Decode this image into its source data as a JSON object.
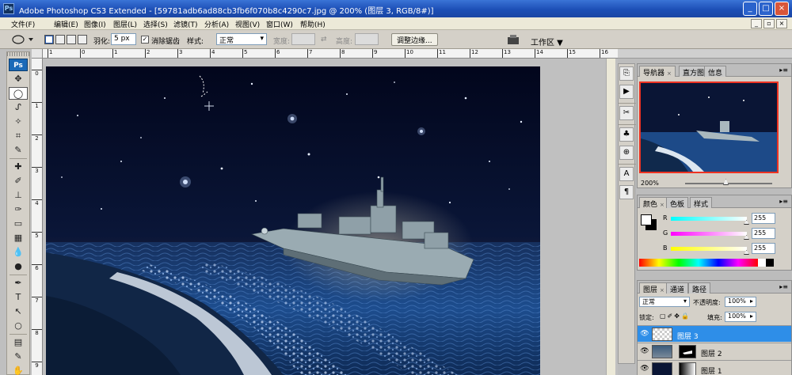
{
  "window": {
    "title": "Adobe Photoshop CS3 Extended - [59781adb6ad88cb3fb6f070b8c4290c7.jpg @ 200% (图层 3, RGB/8#)]",
    "logo": "Ps",
    "controls": [
      "_",
      "□",
      "×"
    ]
  },
  "menu": {
    "items": [
      "文件(F)",
      "编辑(E)",
      "图像(I)",
      "图层(L)",
      "选择(S)",
      "滤镜(T)",
      "分析(A)",
      "视图(V)",
      "窗口(W)",
      "帮助(H)"
    ],
    "doc_controls": [
      "_",
      "▫",
      "×"
    ]
  },
  "options": {
    "feather_label": "羽化:",
    "feather_value": "5 px",
    "antialias_label": "消除锯齿",
    "antialias_checked": true,
    "style_label": "样式:",
    "style_value": "正常",
    "width_label": "宽度:",
    "height_label": "高度:",
    "refine_edge": "调整边缘...",
    "workspace": "工作区 ▼"
  },
  "toolbox": {
    "badge": "Ps",
    "tools": [
      "move-tool",
      "elliptical-marquee-tool",
      "lasso-tool",
      "magic-wand-tool",
      "crop-tool",
      "slice-tool",
      "healing-brush-tool",
      "brush-tool",
      "clone-stamp-tool",
      "history-brush-tool",
      "eraser-tool",
      "gradient-tool",
      "blur-tool",
      "dodge-tool",
      "pen-tool",
      "type-tool",
      "path-selection-tool",
      "ellipse-shape-tool",
      "notes-tool",
      "eyedropper-tool",
      "hand-tool",
      "zoom-tool"
    ],
    "glyphs": [
      "✥",
      "◯",
      "ᔑ",
      "✧",
      "⌗",
      "✎",
      "✚",
      "✐",
      "⊥",
      "✑",
      "▭",
      "▦",
      "💧",
      "●",
      "✒",
      "T",
      "↖",
      "○",
      "▤",
      "✎",
      "✋",
      "🔍"
    ]
  },
  "rulers": {
    "h_labels": [
      "1",
      "0",
      "1",
      "2",
      "3",
      "4",
      "5",
      "6",
      "7",
      "8",
      "9",
      "10",
      "11",
      "12",
      "13",
      "14",
      "15",
      "16"
    ],
    "v_labels": [
      "0",
      "1",
      "2",
      "3",
      "4",
      "5",
      "6",
      "7",
      "8",
      "9"
    ]
  },
  "navigator": {
    "tabs": [
      "导航器",
      "直方图",
      "信息"
    ],
    "zoom": "200%"
  },
  "color": {
    "tabs": [
      "颜色",
      "色板",
      "样式"
    ],
    "channels": [
      {
        "label": "R",
        "value": "255"
      },
      {
        "label": "G",
        "value": "255"
      },
      {
        "label": "B",
        "value": "255"
      }
    ]
  },
  "layers": {
    "tabs": [
      "图层",
      "通道",
      "路径"
    ],
    "blend_mode": "正常",
    "opacity_label": "不透明度:",
    "opacity": "100%",
    "lock_label": "锁定:",
    "fill_label": "填充:",
    "fill": "100%",
    "items": [
      {
        "name": "图层 3",
        "selected": true
      },
      {
        "name": "图层 2",
        "selected": false
      },
      {
        "name": "图层 1",
        "selected": false
      }
    ]
  },
  "colors": {
    "titlebar": "#1d4fb6",
    "selected_layer": "#2e8ee8",
    "panel_bg": "#d4d0c8"
  }
}
